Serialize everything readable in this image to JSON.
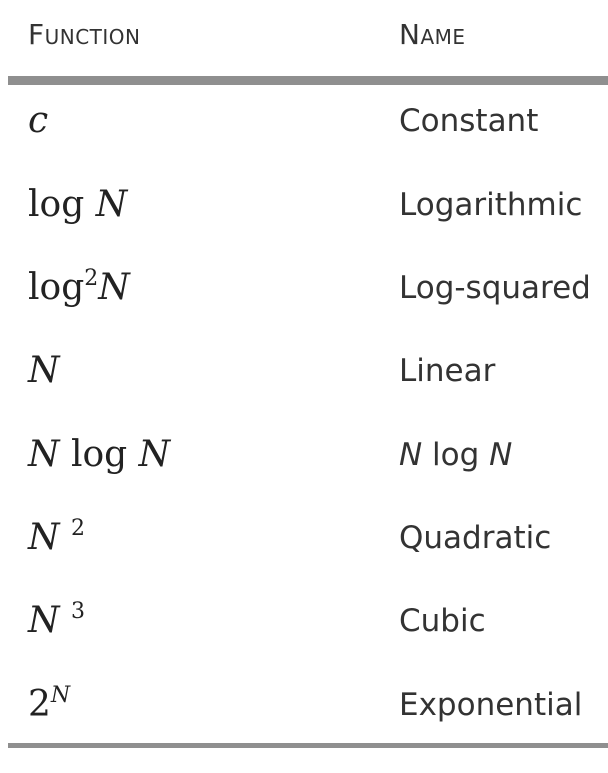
{
  "table": {
    "headers": {
      "function": "Function",
      "name": "Name"
    },
    "rows": [
      {
        "function": "c",
        "name": "Constant"
      },
      {
        "function": "log N",
        "name": "Logarithmic"
      },
      {
        "function": "log²N",
        "name": "Log-squared"
      },
      {
        "function": "N",
        "name": "Linear"
      },
      {
        "function": "N log N",
        "name": "N log N"
      },
      {
        "function": "N²",
        "name": "Quadratic"
      },
      {
        "function": "N³",
        "name": "Cubic"
      },
      {
        "function": "2ᴺ",
        "name": "Exponential"
      }
    ]
  }
}
